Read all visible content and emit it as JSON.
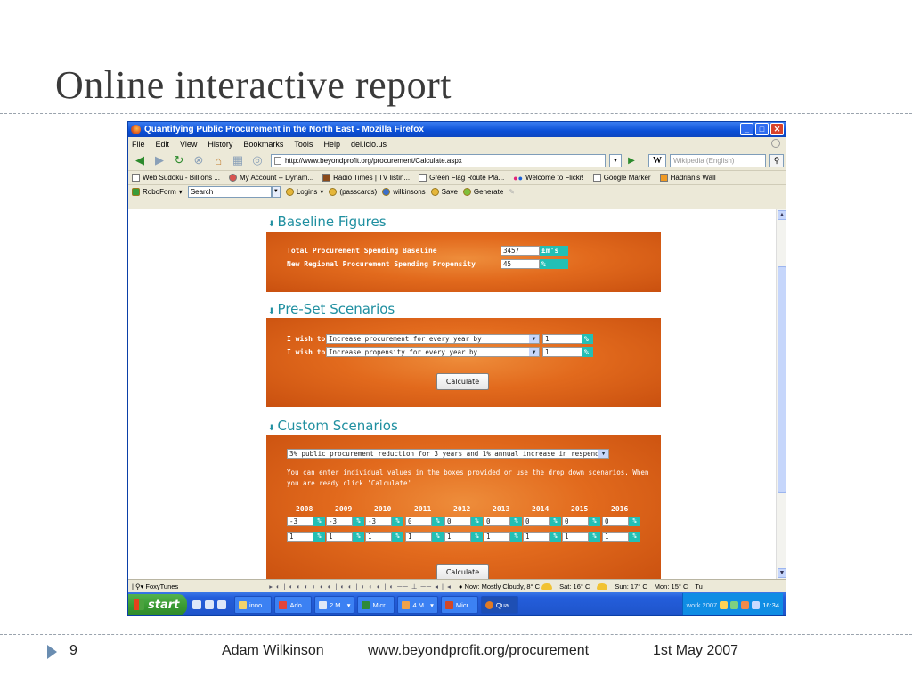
{
  "slide": {
    "title": "Online interactive report",
    "footer": {
      "number": "9",
      "author": "Adam Wilkinson",
      "url": "www.beyondprofit.org/procurement",
      "date": "1st May 2007"
    }
  },
  "browser": {
    "window_title": "Quantifying Public Procurement in the North East - Mozilla Firefox",
    "menu": [
      "File",
      "Edit",
      "View",
      "History",
      "Bookmarks",
      "Tools",
      "Help",
      "del.icio.us"
    ],
    "address": "http://www.beyondprofit.org/procurement/Calculate.aspx",
    "search_engine_letter": "W",
    "search_placeholder": "Wikipedia (English)",
    "bookmarks": [
      "Web Sudoku - Billions ...",
      "My Account -- Dynam...",
      "Radio Times | TV listin...",
      "Green Flag Route Pla...",
      "Welcome to Flickr!",
      "Google Marker",
      "Hadrian's Wall"
    ],
    "roboform": {
      "label": "RoboForm",
      "search_value": "Search",
      "items": [
        "Logins",
        "(passcards)",
        "wilkinsons",
        "Save",
        "Generate"
      ]
    }
  },
  "baseline": {
    "heading": "Baseline Figures",
    "rows": [
      {
        "label": "Total Procurement Spending Baseline",
        "value": "3457",
        "unit": "£m's"
      },
      {
        "label": "New Regional Procurement Spending Propensity",
        "value": "45",
        "unit": "%"
      }
    ]
  },
  "preset": {
    "heading": "Pre-Set Scenarios",
    "rows": [
      {
        "prefix": "I wish to",
        "option": "Increase procurement for every year by",
        "value": "1",
        "unit": "%"
      },
      {
        "prefix": "I wish to",
        "option": "Increase propensity for every year by",
        "value": "1",
        "unit": "%"
      }
    ],
    "calculate_label": "Calculate"
  },
  "custom": {
    "heading": "Custom Scenarios",
    "dropdown": "3% public procurement reduction for 3 years and 1% annual increase in respend",
    "help_line1": "You can enter individual values in the boxes provided or use the drop down scenarios. When",
    "help_line2": "you are ready click 'Calculate'",
    "years": [
      "2008",
      "2009",
      "2010",
      "2011",
      "2012",
      "2013",
      "2014",
      "2015",
      "2016"
    ],
    "row1": [
      "-3",
      "-3",
      "-3",
      "0",
      "0",
      "0",
      "0",
      "0",
      "0"
    ],
    "row2": [
      "1",
      "1",
      "1",
      "1",
      "1",
      "1",
      "1",
      "1",
      "1"
    ],
    "unit": "%",
    "calculate_label": "Calculate"
  },
  "statusbar": {
    "foxytunes": "FoxyTunes",
    "weather_now": "Now: Mostly Cloudy, 8° C",
    "sat": "Sat: 16° C",
    "sun": "Sun: 17° C",
    "mon": "Mon: 15° C",
    "tue": "Tu"
  },
  "taskbar": {
    "start": "start",
    "buttons": [
      "inno...",
      "Ado...",
      "2 M..",
      "Micr...",
      "4 M..",
      "Micr...",
      "Qua..."
    ],
    "work": "work 2007",
    "clock": "16:34"
  }
}
